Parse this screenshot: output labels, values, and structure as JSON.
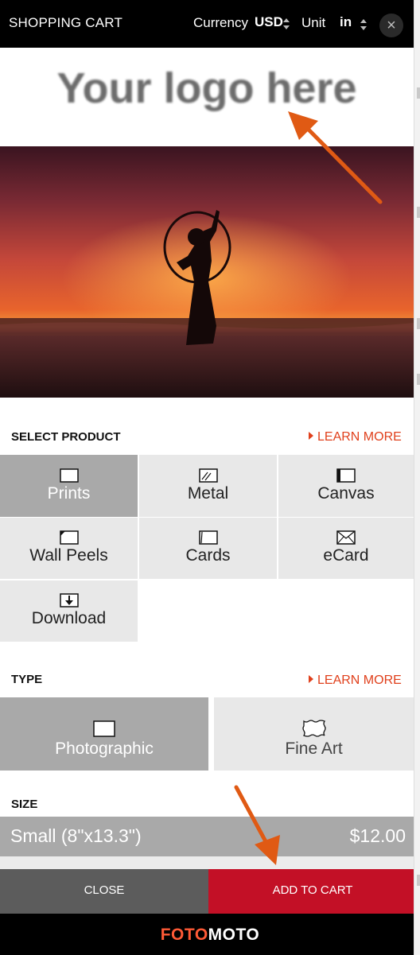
{
  "header": {
    "title": "SHOPPING CART",
    "currency_label": "Currency",
    "currency_value": "USD",
    "unit_label": "Unit",
    "unit_value": "in",
    "close_glyph": "×"
  },
  "logo": {
    "text": "Your logo here"
  },
  "product_section": {
    "title": "SELECT PRODUCT",
    "learn_more": "LEARN MORE",
    "items": [
      {
        "label": "Prints",
        "icon": "print-frame-icon",
        "selected": true
      },
      {
        "label": "Metal",
        "icon": "metal-print-icon",
        "selected": false
      },
      {
        "label": "Canvas",
        "icon": "canvas-icon",
        "selected": false
      },
      {
        "label": "Wall Peels",
        "icon": "wall-peel-icon",
        "selected": false
      },
      {
        "label": "Cards",
        "icon": "card-icon",
        "selected": false
      },
      {
        "label": "eCard",
        "icon": "envelope-icon",
        "selected": false
      },
      {
        "label": "Download",
        "icon": "download-icon",
        "selected": false
      }
    ]
  },
  "type_section": {
    "title": "TYPE",
    "learn_more": "LEARN MORE",
    "items": [
      {
        "label": "Photographic",
        "icon": "photo-paper-icon",
        "selected": true
      },
      {
        "label": "Fine Art",
        "icon": "deckled-paper-icon",
        "selected": false
      }
    ]
  },
  "size_section": {
    "title": "SIZE",
    "selected": {
      "name": "Small (8\"x13.3\")",
      "price": "$12.00"
    }
  },
  "actions": {
    "close": "CLOSE",
    "add_to_cart": "ADD TO CART"
  },
  "footer": {
    "brand_part1": "FOTO",
    "brand_part2": "MOTO"
  },
  "colors": {
    "accent": "#e0401c",
    "add_to_cart": "#c31026",
    "selected_tile": "#a9a9a9",
    "tile": "#e8e8e8",
    "header_bg": "#000000"
  }
}
